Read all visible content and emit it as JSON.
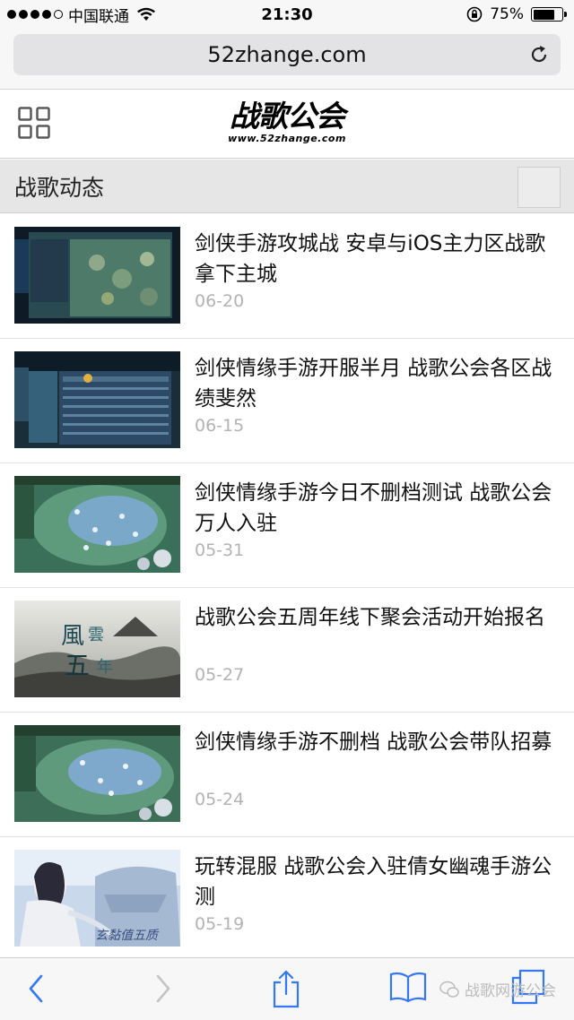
{
  "status_bar": {
    "carrier": "中国联通",
    "time": "21:30",
    "battery": "75%",
    "battery_level": 0.75
  },
  "browser": {
    "url": "52zhange.com"
  },
  "site": {
    "logo_text": "战歌公会",
    "logo_subtext": "www.52zhange.com"
  },
  "section": {
    "title": "战歌动态"
  },
  "news": [
    {
      "title": "剑侠手游攻城战 安卓与iOS主力区战歌拿下主城",
      "date": "06-20",
      "thumb": "game-map-screenshot"
    },
    {
      "title": "剑侠情缘手游开服半月 战歌公会各区战绩斐然",
      "date": "06-15",
      "thumb": "game-ranking-screenshot"
    },
    {
      "title": "剑侠情缘手游今日不删档测试 战歌公会万人入驻",
      "date": "05-31",
      "thumb": "game-battle-screenshot"
    },
    {
      "title": "战歌公会五周年线下聚会活动开始报名",
      "date": "05-27",
      "thumb": "anniversary-poster"
    },
    {
      "title": "剑侠情缘手游不删档 战歌公会带队招募",
      "date": "05-24",
      "thumb": "game-battle-screenshot"
    },
    {
      "title": "玩转混服 战歌公会入驻倩女幽魂手游公测",
      "date": "05-19",
      "thumb": "game-character-art"
    }
  ],
  "thumb_text": {
    "anniversary_a": "風",
    "anniversary_b": "雲",
    "anniversary_c": "五",
    "anniversary_d": "年",
    "character_caption": "玄黏值五质"
  },
  "watermark": "战歌网游公会",
  "colors": {
    "status_bg": "#f7f7f7",
    "url_field": "#e3e3e5",
    "section_bg": "#e6e6e6",
    "date_gray": "#b3b3b3",
    "ios_blue": "#3478f6"
  }
}
